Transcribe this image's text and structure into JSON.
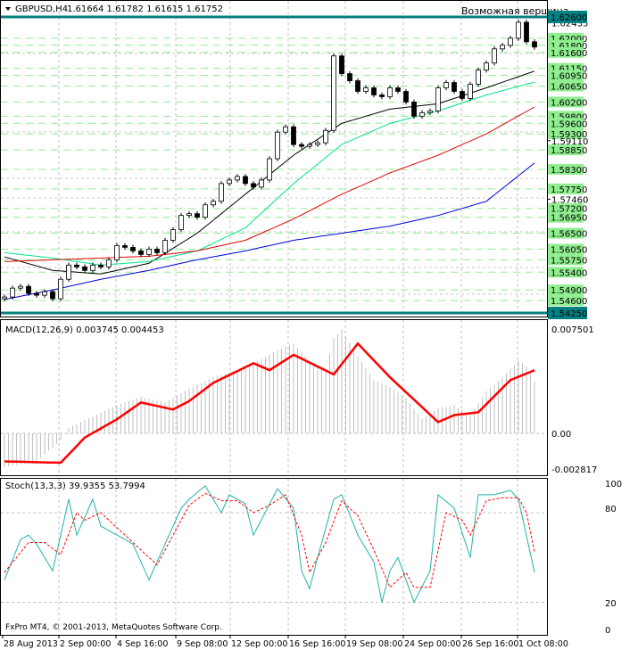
{
  "header": {
    "symbol": "GBPUSD,H4",
    "ohlc": "1.61664 1.61782 1.61615 1.61752"
  },
  "annotation": "Возможная вершина",
  "footer": "FxPro MT4, © 2001-2013, MetaQuotes Software Corp.",
  "colors": {
    "teal": "#008080",
    "level": "#90ee90",
    "ma_black": "#000000",
    "ma_green": "#00e08a",
    "ma_red": "#e00000",
    "ma_blue": "#0000dd",
    "macd_hist": "#c0c0c0",
    "macd_signal": "#ff0000",
    "stoch_k": "#20b2aa",
    "stoch_d": "#ff0000",
    "annotation": "#0000ff"
  },
  "chart_data": [
    {
      "type": "candlestick",
      "title": "GBPUSD,H4",
      "ylim": [
        1.5413,
        1.6306
      ],
      "x_tick_labels": [
        "28 Aug 2013",
        "2 Sep 00:00",
        "4 Sep 16:00",
        "9 Sep 08:00",
        "12 Sep 00:00",
        "16 Sep 16:00",
        "19 Sep 08:00",
        "24 Sep 00:00",
        "26 Sep 16:00",
        "1 Oct 08:00"
      ],
      "y_tick_labels": [
        "1.62435",
        "1.59110",
        "1.57460"
      ],
      "close": [
        1.547,
        1.5495,
        1.55,
        1.548,
        1.5475,
        1.5485,
        1.5465,
        1.552,
        1.556,
        1.5555,
        1.5545,
        1.556,
        1.5555,
        1.5575,
        1.5615,
        1.561,
        1.56,
        1.559,
        1.5605,
        1.5595,
        1.563,
        1.566,
        1.57,
        1.5705,
        1.5695,
        1.573,
        1.574,
        1.579,
        1.58,
        1.581,
        1.579,
        1.578,
        1.58,
        1.586,
        1.5935,
        1.595,
        1.59,
        1.5895,
        1.59,
        1.5905,
        1.594,
        1.615,
        1.61,
        1.608,
        1.605,
        1.606,
        1.604,
        1.6035,
        1.606,
        1.605,
        1.602,
        1.598,
        1.599,
        1.5995,
        1.606,
        1.6075,
        1.605,
        1.603,
        1.607,
        1.611,
        1.613,
        1.617,
        1.618,
        1.62,
        1.6245,
        1.619,
        1.6175
      ],
      "moving_averages": [
        {
          "name": "black",
          "points": [
            [
              0,
              1.5583
            ],
            [
              6,
              1.5545
            ],
            [
              12,
              1.5535
            ],
            [
              18,
              1.5565
            ],
            [
              24,
              1.565
            ],
            [
              30,
              1.576
            ],
            [
              36,
              1.587
            ],
            [
              42,
              1.596
            ],
            [
              48,
              1.6
            ],
            [
              54,
              1.6015
            ],
            [
              60,
              1.606
            ],
            [
              66,
              1.6107
            ]
          ]
        },
        {
          "name": "green",
          "points": [
            [
              0,
              1.5595
            ],
            [
              6,
              1.558
            ],
            [
              12,
              1.556
            ],
            [
              18,
              1.557
            ],
            [
              24,
              1.56
            ],
            [
              30,
              1.5665
            ],
            [
              36,
              1.579
            ],
            [
              42,
              1.59
            ],
            [
              48,
              1.596
            ],
            [
              54,
              1.5995
            ],
            [
              60,
              1.604
            ],
            [
              66,
              1.6076
            ]
          ]
        },
        {
          "name": "red",
          "points": [
            [
              0,
              1.557
            ],
            [
              6,
              1.5575
            ],
            [
              12,
              1.558
            ],
            [
              18,
              1.5585
            ],
            [
              24,
              1.56
            ],
            [
              30,
              1.563
            ],
            [
              36,
              1.569
            ],
            [
              42,
              1.576
            ],
            [
              48,
              1.582
            ],
            [
              54,
              1.587
            ],
            [
              60,
              1.593
            ],
            [
              66,
              1.6006
            ]
          ]
        },
        {
          "name": "blue",
          "points": [
            [
              0,
              1.5463
            ],
            [
              6,
              1.549
            ],
            [
              12,
              1.552
            ],
            [
              18,
              1.5545
            ],
            [
              24,
              1.5575
            ],
            [
              30,
              1.56
            ],
            [
              36,
              1.563
            ],
            [
              42,
              1.565
            ],
            [
              48,
              1.567
            ],
            [
              54,
              1.57
            ],
            [
              60,
              1.574
            ],
            [
              66,
              1.5848
            ]
          ]
        }
      ],
      "levels": [
        "1.62000",
        "1.61800",
        "1.61600",
        "1.61150",
        "1.60950",
        "1.60650",
        "1.60200",
        "1.59800",
        "1.59600",
        "1.59300",
        "1.58850",
        "1.58300",
        "1.57750",
        "1.57200",
        "1.56950",
        "1.56500",
        "1.56050",
        "1.55750",
        "1.55400",
        "1.54900",
        "1.54600"
      ],
      "key_levels": [
        "1.62600",
        "1.54250"
      ]
    },
    {
      "type": "bar+line",
      "title": "MACD(12,26,9) 0.003745 0.004453",
      "ylim": [
        -0.002817,
        0.007501
      ],
      "y_tick_labels": [
        "0.007501",
        "0.00",
        "-0.002817"
      ],
      "histogram_points": [
        [
          0,
          -0.0024
        ],
        [
          4,
          -0.002
        ],
        [
          7,
          -0.0005
        ],
        [
          8,
          0.0004
        ],
        [
          11,
          0.0012
        ],
        [
          14,
          0.002
        ],
        [
          17,
          0.0026
        ],
        [
          20,
          0.0022
        ],
        [
          23,
          0.0032
        ],
        [
          26,
          0.004
        ],
        [
          29,
          0.0045
        ],
        [
          32,
          0.0053
        ],
        [
          35,
          0.0062
        ],
        [
          36,
          0.0064
        ],
        [
          38,
          0.0052
        ],
        [
          40,
          0.0045
        ],
        [
          41,
          0.0068
        ],
        [
          42,
          0.0074
        ],
        [
          44,
          0.0055
        ],
        [
          46,
          0.0038
        ],
        [
          48,
          0.0033
        ],
        [
          50,
          0.0025
        ],
        [
          52,
          0.001
        ],
        [
          54,
          0.0018
        ],
        [
          56,
          0.002
        ],
        [
          58,
          0.0013
        ],
        [
          60,
          0.003
        ],
        [
          62,
          0.004
        ],
        [
          64,
          0.0052
        ],
        [
          65,
          0.0048
        ],
        [
          66,
          0.0037
        ]
      ],
      "signal_points": [
        [
          0,
          -0.002
        ],
        [
          7,
          -0.0021
        ],
        [
          10,
          -0.0003
        ],
        [
          14,
          0.001
        ],
        [
          17,
          0.0022
        ],
        [
          21,
          0.0017
        ],
        [
          23,
          0.0023
        ],
        [
          26,
          0.0036
        ],
        [
          31,
          0.005
        ],
        [
          33,
          0.0045
        ],
        [
          36,
          0.0056
        ],
        [
          41,
          0.0042
        ],
        [
          44,
          0.0064
        ],
        [
          48,
          0.004
        ],
        [
          54,
          0.0008
        ],
        [
          56,
          0.0013
        ],
        [
          59,
          0.0015
        ],
        [
          63,
          0.0038
        ],
        [
          66,
          0.0045
        ]
      ]
    },
    {
      "type": "line",
      "title": "Stoch(13,3,3) 39.9355 53.7994",
      "ylim": [
        0,
        100
      ],
      "y_tick_labels": [
        "100",
        "80",
        "20",
        "0"
      ],
      "k_points": [
        [
          0,
          35
        ],
        [
          2,
          62
        ],
        [
          3,
          65
        ],
        [
          4,
          59
        ],
        [
          6,
          41
        ],
        [
          8,
          89
        ],
        [
          9,
          65
        ],
        [
          11,
          89
        ],
        [
          12,
          71
        ],
        [
          14,
          65
        ],
        [
          16,
          59
        ],
        [
          18,
          35
        ],
        [
          20,
          59
        ],
        [
          22,
          83
        ],
        [
          23,
          89
        ],
        [
          25,
          98
        ],
        [
          27,
          80
        ],
        [
          28,
          92
        ],
        [
          30,
          86
        ],
        [
          31,
          65
        ],
        [
          34,
          96
        ],
        [
          36,
          83
        ],
        [
          37,
          41
        ],
        [
          38,
          29
        ],
        [
          39,
          50
        ],
        [
          41,
          89
        ],
        [
          42,
          92
        ],
        [
          44,
          65
        ],
        [
          46,
          47
        ],
        [
          47,
          20
        ],
        [
          48,
          41
        ],
        [
          49,
          50
        ],
        [
          51,
          20
        ],
        [
          53,
          41
        ],
        [
          54,
          92
        ],
        [
          56,
          83
        ],
        [
          58,
          50
        ],
        [
          59,
          92
        ],
        [
          61,
          92
        ],
        [
          63,
          95
        ],
        [
          64,
          89
        ],
        [
          66,
          40
        ]
      ],
      "d_points": [
        [
          0,
          40
        ],
        [
          3,
          60
        ],
        [
          5,
          60
        ],
        [
          7,
          52
        ],
        [
          9,
          80
        ],
        [
          10,
          75
        ],
        [
          12,
          80
        ],
        [
          14,
          70
        ],
        [
          17,
          55
        ],
        [
          19,
          45
        ],
        [
          21,
          65
        ],
        [
          23,
          85
        ],
        [
          25,
          93
        ],
        [
          27,
          88
        ],
        [
          29,
          88
        ],
        [
          31,
          80
        ],
        [
          33,
          85
        ],
        [
          35,
          92
        ],
        [
          37,
          65
        ],
        [
          38,
          40
        ],
        [
          40,
          60
        ],
        [
          42,
          88
        ],
        [
          44,
          78
        ],
        [
          46,
          55
        ],
        [
          48,
          30
        ],
        [
          50,
          40
        ],
        [
          51,
          30
        ],
        [
          53,
          30
        ],
        [
          55,
          80
        ],
        [
          57,
          75
        ],
        [
          58,
          65
        ],
        [
          60,
          88
        ],
        [
          62,
          90
        ],
        [
          64,
          90
        ],
        [
          65,
          80
        ],
        [
          66,
          54
        ]
      ]
    }
  ]
}
